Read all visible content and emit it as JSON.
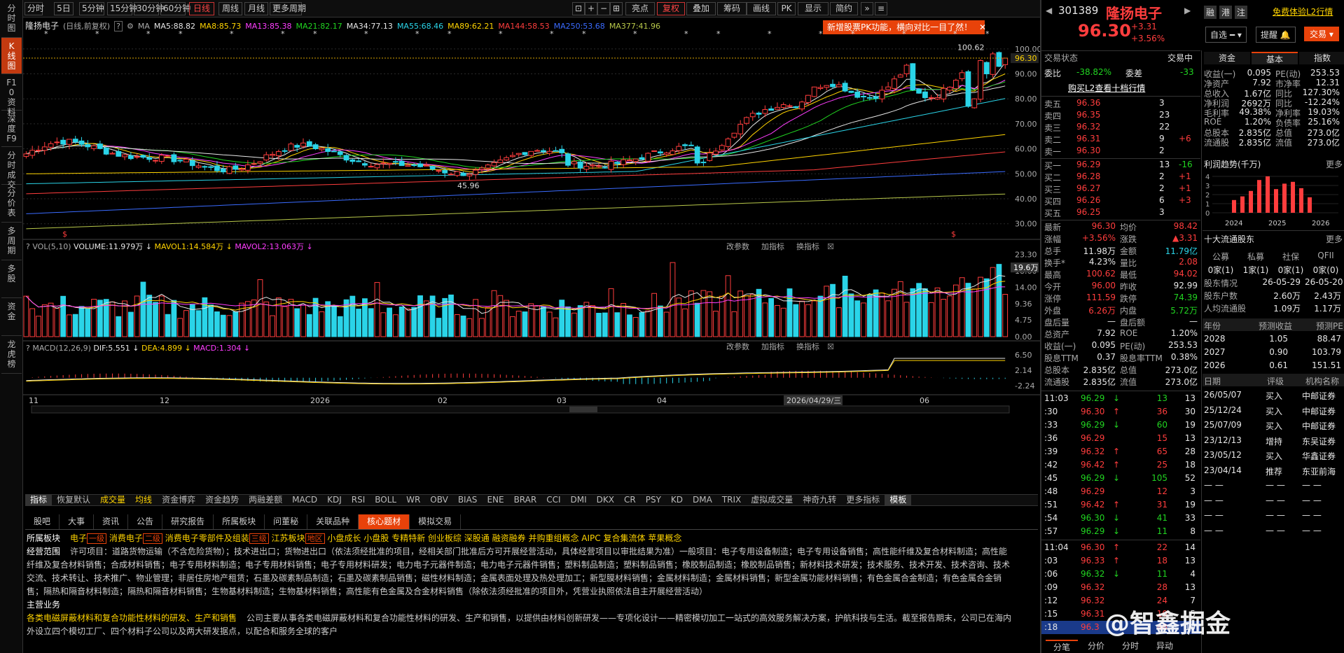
{
  "left_tabs": [
    "分时图",
    "K线图",
    "F10资料",
    "深度F9",
    "分时成交",
    "分价表",
    "多周期",
    "多股",
    "资金",
    "龙虎榜"
  ],
  "toolbar": {
    "periods": [
      "分时",
      "5日",
      "5分钟",
      "15分钟",
      "30分钟",
      "60分钟",
      "日线",
      "周线",
      "月线",
      "更多周期"
    ],
    "tools": [
      "亮点",
      "复权",
      "叠加",
      "筹码",
      "画线",
      "PK",
      "显示",
      "简约"
    ]
  },
  "ma_header": {
    "name": "隆扬电子",
    "period": "(日线,前复权)",
    "ma": "MA",
    "items": [
      {
        "t": "MA5:88.82",
        "c": "#e6e6e6"
      },
      {
        "t": "MA8:85.73",
        "c": "#ffd400"
      },
      {
        "t": "MA13:85.38",
        "c": "#ff3dff"
      },
      {
        "t": "MA21:82.17",
        "c": "#21d421"
      },
      {
        "t": "MA34:77.13",
        "c": "#e6e6e6"
      },
      {
        "t": "MA55:68.46",
        "c": "#2ad4e8"
      },
      {
        "t": "MA89:62.21",
        "c": "#ffd400"
      },
      {
        "t": "MA144:58.53",
        "c": "#ff3d3d"
      },
      {
        "t": "MA250:53.68",
        "c": "#3a6bff"
      },
      {
        "t": "MA377:41.96",
        "c": "#b8c84a"
      }
    ]
  },
  "notice": "新增股票PK功能，横向对比一目了然！",
  "price_axis": [
    "100.00",
    "90.00",
    "80.00",
    "70.00",
    "60.00",
    "50.00",
    "40.00",
    "30.00"
  ],
  "current_price_label": "96.30",
  "high_label": "100.62",
  "low_label": "45.96",
  "vol_header": {
    "name": "VOL(5,10)",
    "volume": "VOLUME:11.979万",
    "mavol1": "MAVOL1:14.584万",
    "mavol2": "MAVOL2:13.063万"
  },
  "vol_axis": [
    "23.30",
    "18.60",
    "14.00",
    "9.36",
    "4.75",
    "0.00"
  ],
  "vol_badge": "19.6万",
  "macd_header": {
    "name": "MACD(12,26,9)",
    "dif": "DIF:5.551",
    "dea": "DEA:4.899",
    "macd": "MACD:1.304"
  },
  "macd_axis": [
    "6.50",
    "2.14",
    "-2.24"
  ],
  "panel_actions": [
    "改参数",
    "加指标",
    "换指标"
  ],
  "date_axis": [
    "11",
    "12",
    "2026",
    "02",
    "03",
    "04",
    "2026/04/29/三",
    "06"
  ],
  "indicator_tabs": [
    "指标",
    "恢复默认",
    "成交量",
    "均线",
    "资金博弈",
    "资金趋势",
    "两融差额",
    "MACD",
    "KDJ",
    "RSI",
    "BOLL",
    "WR",
    "OBV",
    "BIAS",
    "ENE",
    "BRAR",
    "CCI",
    "DMI",
    "DKX",
    "CR",
    "PSY",
    "KD",
    "DMA",
    "TRIX",
    "虚拟成交量",
    "神奇九转",
    "更多指标",
    "模板"
  ],
  "info_tabs": [
    "股吧",
    "大事",
    "资讯",
    "公告",
    "研究报告",
    "所属板块",
    "问董秘",
    "关联品种",
    "核心题材",
    "模拟交易"
  ],
  "info_body": {
    "sector_label": "所属板块",
    "sectors": [
      {
        "t": "电子",
        "tag": "一级"
      },
      {
        "t": "消费电子",
        "tag": "二级"
      },
      {
        "t": "消费电子零部件及组装",
        "tag": "三级"
      },
      {
        "t": "江苏板块",
        "tag": "地区"
      },
      {
        "t": "小盘成长"
      },
      {
        "t": "小盘股"
      },
      {
        "t": "专精特新"
      },
      {
        "t": "创业板综"
      },
      {
        "t": "深股通"
      },
      {
        "t": "融资融券"
      },
      {
        "t": "并购重组概念"
      },
      {
        "t": "AIPC"
      },
      {
        "t": "复合集流体"
      },
      {
        "t": "苹果概念"
      }
    ],
    "scope_label": "经营范围",
    "scope": "许可项目：道路货物运输（不含危险货物）；技术进出口；货物进出口（依法须经批准的项目，经相关部门批准后方可开展经营活动，具体经营项目以审批结果为准）一般项目：电子专用设备制造；电子专用设备销售；高性能纤维及复合材料制造；高性能纤维及复合材料销售；合成材料销售；电子专用材料制造；电子专用材料销售；电子专用材料研发；电力电子元器件制造；电力电子元器件销售；塑料制品制造；塑料制品销售；橡胶制品制造；橡胶制品销售；新材料技术研发；技术服务、技术开发、技术咨询、技术交流、技术转让、技术推广、物业管理；非居住房地产租赁；石墨及碳素制品制造；石墨及碳素制品销售；磁性材料制造；金属表面处理及热处理加工；新型膜材料销售；金属材料制造；金属材料销售；新型金属功能材料销售；有色金属合金制造；有色金属合金销售；隔热和隔音材料制造；隔热和隔音材料销售；生物基材料制造；生物基材料销售；高性能有色金属及合金材料销售（除依法须经批准的项目外，凭营业执照依法自主开展经营活动）",
    "main_label": "主营业务",
    "main_title": "各类电磁屏蔽材料和复合功能性材料的研发、生产和销售",
    "main_text": "公司主要从事各类电磁屏蔽材料和复合功能性材料的研发、生产和销售，以提供由材料创新研发——专项化设计——精密模切加工一站式的高效服务解决方案，护航科技与生活。截至报告期末，公司已在海内外设立四个模切工厂、四个材料子公司以及两大研发据点，以配合和服务全球的客户"
  },
  "stock": {
    "code": "301389",
    "name": "隆扬电子",
    "price": "96.30",
    "change": "+3.31",
    "pct": "+3.56%",
    "badges": [
      "融",
      "港",
      "注"
    ],
    "trial": "免费体验L2行情",
    "buttons": [
      "自选",
      "提醒",
      "交易"
    ],
    "status_l": "交易状态",
    "status_r": "交易中"
  },
  "ratio": {
    "wb_label": "委比",
    "wb": "-38.82%",
    "wc_label": "委差",
    "wc": "-33"
  },
  "l2_link": "购买L2查看十档行情",
  "asks": [
    {
      "n": "卖五",
      "p": "96.36",
      "v": "3",
      "d": ""
    },
    {
      "n": "卖四",
      "p": "96.35",
      "v": "23",
      "d": ""
    },
    {
      "n": "卖三",
      "p": "96.32",
      "v": "22",
      "d": ""
    },
    {
      "n": "卖二",
      "p": "96.31",
      "v": "9",
      "d": "+6"
    },
    {
      "n": "卖一",
      "p": "96.30",
      "v": "2",
      "d": ""
    }
  ],
  "bids": [
    {
      "n": "买一",
      "p": "96.29",
      "v": "13",
      "d": "-16"
    },
    {
      "n": "买二",
      "p": "96.28",
      "v": "2",
      "d": "+1"
    },
    {
      "n": "买三",
      "p": "96.27",
      "v": "2",
      "d": "+1"
    },
    {
      "n": "买四",
      "p": "96.26",
      "v": "6",
      "d": "+3"
    },
    {
      "n": "买五",
      "p": "96.25",
      "v": "3",
      "d": ""
    }
  ],
  "quote": [
    [
      "最新",
      "96.30",
      "red",
      "均价",
      "98.42",
      "red"
    ],
    [
      "涨幅",
      "+3.56%",
      "red",
      "涨跌",
      "▲3.31",
      "red"
    ],
    [
      "总手",
      "11.98万",
      "white",
      "金额",
      "11.79亿",
      "cyan"
    ],
    [
      "换手*",
      "4.23%",
      "white",
      "量比",
      "2.08",
      "red"
    ],
    [
      "最高",
      "100.62",
      "red",
      "最低",
      "94.02",
      "red"
    ],
    [
      "今开",
      "96.00",
      "red",
      "昨收",
      "92.99",
      "white"
    ],
    [
      "涨停",
      "111.59",
      "red",
      "跌停",
      "74.39",
      "green"
    ],
    [
      "外盘",
      "6.26万",
      "red",
      "内盘",
      "5.72万",
      "green"
    ],
    [
      "盘后量",
      "—",
      "white",
      "盘后额",
      "—",
      "white"
    ],
    [
      "总资产",
      "7.92",
      "white",
      "ROE",
      "1.20%",
      "white"
    ],
    [
      "收益(一)",
      "0.095",
      "white",
      "PE(动)",
      "253.53",
      "white"
    ],
    [
      "股息TTM",
      "0.37",
      "white",
      "股息率TTM",
      "0.38%",
      "white"
    ],
    [
      "总股本",
      "2.835亿",
      "white",
      "总值",
      "273.0亿",
      "white"
    ],
    [
      "流通股",
      "2.835亿",
      "white",
      "流值",
      "273.0亿",
      "white"
    ]
  ],
  "ticks": [
    [
      "11:03",
      "96.29",
      "13",
      "13",
      "g"
    ],
    [
      ":30",
      "96.30",
      "36",
      "30",
      "r"
    ],
    [
      ":33",
      "96.29",
      "60",
      "19",
      "g"
    ],
    [
      ":36",
      "96.29",
      "15",
      "13",
      "n"
    ],
    [
      ":39",
      "96.32",
      "65",
      "28",
      "r"
    ],
    [
      ":42",
      "96.42",
      "25",
      "18",
      "r"
    ],
    [
      ":45",
      "96.29",
      "105",
      "52",
      "g"
    ],
    [
      ":48",
      "96.29",
      "12",
      "3",
      "n"
    ],
    [
      ":51",
      "96.42",
      "31",
      "19",
      "r"
    ],
    [
      ":54",
      "96.30",
      "41",
      "33",
      "g"
    ],
    [
      ":57",
      "96.29",
      "11",
      "8",
      "g"
    ],
    [
      "11:04",
      "96.30",
      "22",
      "14",
      "r"
    ],
    [
      ":03",
      "96.33",
      "18",
      "13",
      "r"
    ],
    [
      ":06",
      "96.32",
      "11",
      "4",
      "g"
    ],
    [
      ":09",
      "96.32",
      "28",
      "13",
      "n"
    ],
    [
      ":12",
      "96.32",
      "24",
      "7",
      "n"
    ],
    [
      ":15",
      "96.31",
      "10",
      "5",
      "n"
    ],
    [
      ":18",
      "96.3",
      "48",
      "10",
      "n"
    ]
  ],
  "bottom_tabs": [
    "分笔",
    "分价",
    "分时",
    "异动"
  ],
  "fund_tabs": [
    "资金",
    "基本",
    "指数"
  ],
  "fundamentals": [
    [
      "收益(一)",
      "0.095",
      "PE(动)",
      "253.53"
    ],
    [
      "净资产",
      "7.92",
      "市净率",
      "12.31"
    ],
    [
      "总收入",
      "1.67亿",
      "同比",
      "127.30%"
    ],
    [
      "净利润",
      "2692万",
      "同比",
      "-12.24%"
    ],
    [
      "毛利率",
      "49.38%",
      "净利率",
      "19.03%"
    ],
    [
      "ROE",
      "1.20%",
      "负债率",
      "25.16%"
    ],
    [
      "总股本",
      "2.835亿",
      "总值",
      "273.0亿"
    ],
    [
      "流通股",
      "2.835亿",
      "流值",
      "273.0亿"
    ]
  ],
  "profit_trend": {
    "title": "利润趋势(千万)",
    "more": "更多",
    "years": [
      "2024",
      "2025",
      "2026"
    ],
    "yaxis": [
      "4",
      "3",
      "2",
      "1",
      "0"
    ],
    "values": [
      1.4,
      1.8,
      2.4,
      3.6,
      4.0,
      2.6,
      3.2,
      3.4,
      2.7,
      1.7
    ]
  },
  "holders": {
    "title": "十大流通股东",
    "more": "更多",
    "cols": [
      "公募",
      "私募",
      "社保",
      "QFII"
    ],
    "vals": [
      "0家(1)",
      "1家(1)",
      "0家(1)",
      "0家(0)"
    ],
    "rows": [
      [
        "股东情况",
        "26-05-29",
        "26-05-20"
      ],
      [
        "股东户数",
        "2.60万",
        "2.43万"
      ],
      [
        "人均流通股",
        "1.09万",
        "1.17万"
      ]
    ]
  },
  "forecast": {
    "cols": [
      "年份",
      "预测收益",
      "预测PE"
    ],
    "rows": [
      [
        "2028",
        "1.05",
        "88.47"
      ],
      [
        "2027",
        "0.90",
        "103.79"
      ],
      [
        "2026",
        "0.61",
        "151.51"
      ]
    ]
  },
  "ratings": {
    "cols": [
      "日期",
      "评级",
      "机构名称"
    ],
    "rows": [
      [
        "26/05/07",
        "买入",
        "中邮证券"
      ],
      [
        "25/12/24",
        "买入",
        "中邮证券"
      ],
      [
        "25/07/09",
        "买入",
        "中邮证券"
      ],
      [
        "23/12/13",
        "增持",
        "东吴证券"
      ],
      [
        "23/05/12",
        "买入",
        "华鑫证券"
      ],
      [
        "23/04/14",
        "推荐",
        "东亚前海"
      ],
      [
        "— —",
        "— —",
        "— —"
      ],
      [
        "— —",
        "— —",
        "— —"
      ],
      [
        "— —",
        "— —",
        "— —"
      ],
      [
        "— —",
        "— —",
        "— —"
      ]
    ]
  },
  "watermark": "@智鑫掘金"
}
